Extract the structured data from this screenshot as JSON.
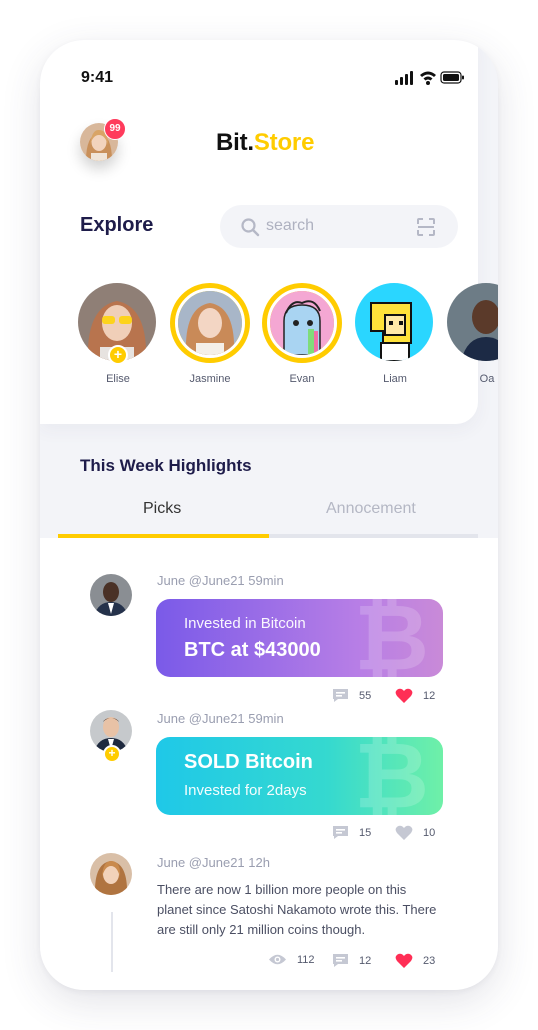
{
  "status_bar": {
    "time": "9:41"
  },
  "header": {
    "badge_count": "99",
    "brand_part1": "Bit.",
    "brand_part2": "Store"
  },
  "explore": {
    "title": "Explore",
    "search_placeholder": "search"
  },
  "stories": [
    {
      "name": "Elise",
      "has_plus": true,
      "active": false
    },
    {
      "name": "Jasmine",
      "active": true
    },
    {
      "name": "Evan",
      "active": true
    },
    {
      "name": "Liam",
      "active": false
    },
    {
      "name": "Oa",
      "active": false
    }
  ],
  "highlights": {
    "title": "This Week Highlights",
    "tabs": [
      {
        "label": "Picks",
        "selected": true
      },
      {
        "label": "Annocement",
        "selected": false
      }
    ]
  },
  "posts": [
    {
      "meta": "June @June21  59min",
      "card_line1": "Invested in Bitcoin",
      "card_line2": "BTC at $43000",
      "watermark": "₿",
      "comments": "55",
      "likes": "12",
      "liked": true
    },
    {
      "meta": "June @June21  59min",
      "card_line1": "SOLD Bitcoin",
      "card_line2": "Invested for 2days",
      "watermark": "₿",
      "comments": "15",
      "likes": "10",
      "liked": false
    },
    {
      "meta": "June @June21  12h",
      "text": "There are now 1 billion more people on this planet since Satoshi Nakamoto wrote this. There are still only 21 million coins though.",
      "views": "112",
      "comments": "12",
      "likes": "23",
      "liked": true
    }
  ],
  "colors": {
    "accent": "#ffcc00",
    "brand_dark": "#1e1c4a",
    "heart": "#ff2e55",
    "badge": "#ff3b5c"
  }
}
